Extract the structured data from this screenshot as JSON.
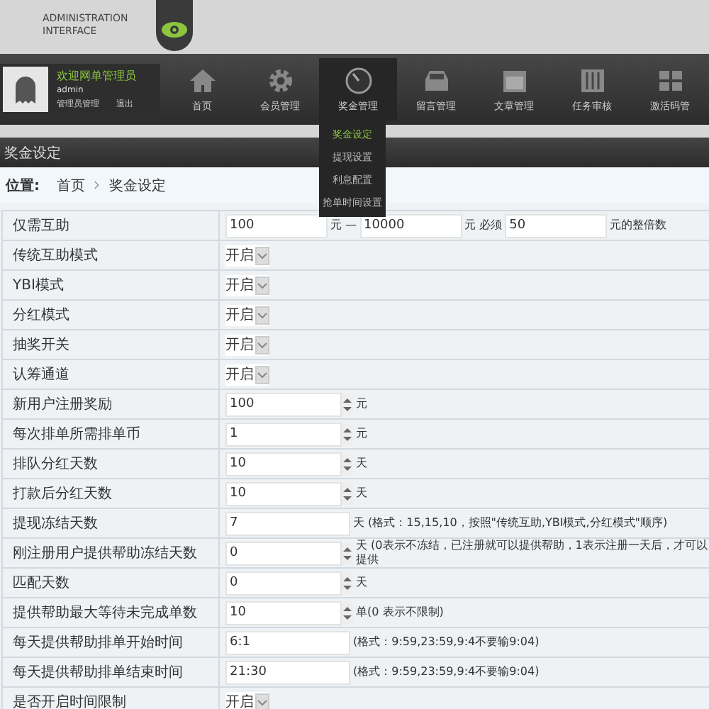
{
  "header": {
    "logo_line_1": "ADMINISTRATION",
    "logo_line_2": "INTERFACE"
  },
  "user": {
    "welcome": "欢迎网单管理员",
    "name": "admin",
    "links": [
      "管理员管理",
      "退出"
    ]
  },
  "nav": [
    {
      "label": "首页",
      "selected": false
    },
    {
      "label": "会员管理",
      "selected": false
    },
    {
      "label": "奖金管理",
      "selected": true
    },
    {
      "label": "留言管理",
      "selected": false
    },
    {
      "label": "文章管理",
      "selected": false
    },
    {
      "label": "任务审核",
      "selected": false
    },
    {
      "label": "激活码管",
      "selected": false
    }
  ],
  "submenu": [
    {
      "label": "奖金设定",
      "selected": true
    },
    {
      "label": "提现设置",
      "selected": false
    },
    {
      "label": "利息配置",
      "selected": false
    },
    {
      "label": "抢单时间设置",
      "selected": false
    }
  ],
  "page_title": "奖金设定",
  "breadcrumb": {
    "label": "位置:",
    "items": [
      "首页",
      "奖金设定"
    ]
  },
  "rows": [
    {
      "label": "仅需互助",
      "controls": [
        {
          "kind": "input",
          "value": "100"
        },
        {
          "kind": "text",
          "text": "元 —"
        },
        {
          "kind": "input",
          "value": "10000"
        },
        {
          "kind": "text",
          "text": "元 必须"
        },
        {
          "kind": "input",
          "value": "50"
        },
        {
          "kind": "text",
          "text": "元的整倍数"
        }
      ]
    },
    {
      "label": "传统互助模式",
      "controls": [
        {
          "kind": "select",
          "value": "开启"
        }
      ]
    },
    {
      "label": "YBI模式",
      "controls": [
        {
          "kind": "select",
          "value": "开启"
        }
      ]
    },
    {
      "label": "分红模式",
      "controls": [
        {
          "kind": "select",
          "value": "开启"
        }
      ]
    },
    {
      "label": "抽奖开关",
      "controls": [
        {
          "kind": "select",
          "value": "开启"
        }
      ]
    },
    {
      "label": "认筹通道",
      "controls": [
        {
          "kind": "select",
          "value": "开启"
        }
      ]
    },
    {
      "label": "新用户注册奖励",
      "controls": [
        {
          "kind": "spinner",
          "value": "100"
        },
        {
          "kind": "text",
          "text": "元"
        }
      ]
    },
    {
      "label": "每次排单所需排单币",
      "controls": [
        {
          "kind": "spinner",
          "value": "1"
        },
        {
          "kind": "text",
          "text": "元"
        }
      ]
    },
    {
      "label": "排队分红天数",
      "controls": [
        {
          "kind": "spinner",
          "value": "10"
        },
        {
          "kind": "text",
          "text": "天"
        }
      ]
    },
    {
      "label": "打款后分红天数",
      "controls": [
        {
          "kind": "spinner",
          "value": "10"
        },
        {
          "kind": "text",
          "text": "天"
        }
      ]
    },
    {
      "label": "提现冻结天数",
      "controls": [
        {
          "kind": "input",
          "value": "7"
        },
        {
          "kind": "text",
          "text": "天 (格式：15,15,10，按照\"传统互助,YBI模式,分红模式\"顺序)"
        }
      ]
    },
    {
      "label": "刚注册用户提供帮助冻结天数",
      "controls": [
        {
          "kind": "spinner",
          "value": "0"
        },
        {
          "kind": "text",
          "text": "天 (0表示不冻结，已注册就可以提供帮助，1表示注册一天后，才可以提供"
        }
      ]
    },
    {
      "label": "匹配天数",
      "controls": [
        {
          "kind": "spinner",
          "value": "0"
        },
        {
          "kind": "text",
          "text": "天"
        }
      ]
    },
    {
      "label": "提供帮助最大等待未完成单数",
      "controls": [
        {
          "kind": "spinner",
          "value": "10"
        },
        {
          "kind": "text",
          "text": "单(0 表示不限制)"
        }
      ]
    },
    {
      "label": "每天提供帮助排单开始时间",
      "controls": [
        {
          "kind": "input",
          "value": "6:1"
        },
        {
          "kind": "text",
          "text": "(格式：9:59,23:59,9:4不要输9:04)"
        }
      ]
    },
    {
      "label": "每天提供帮助排单结束时间",
      "controls": [
        {
          "kind": "input",
          "value": "21:30"
        },
        {
          "kind": "text",
          "text": "(格式：9:59,23:59,9:4不要输9:04)"
        }
      ]
    },
    {
      "label": "是否开启时间限制",
      "controls": [
        {
          "kind": "select",
          "value": "开启"
        }
      ]
    }
  ]
}
